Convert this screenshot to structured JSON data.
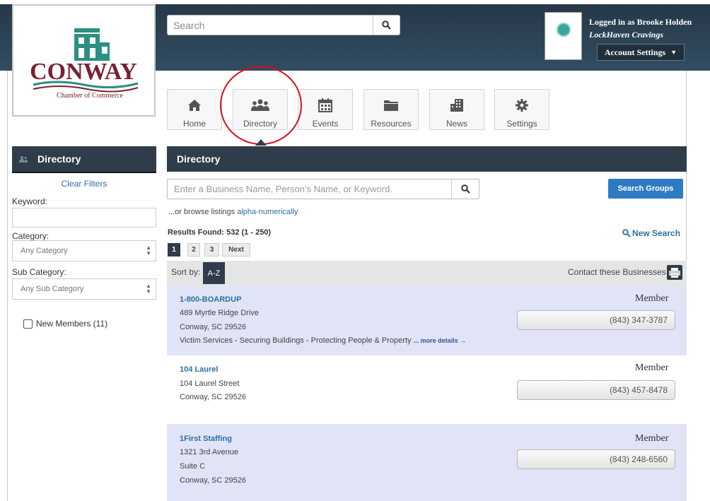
{
  "header": {
    "search_placeholder": "Search",
    "logged_in_as": "Logged in as Brooke Holden",
    "business": "LockHaven Cravings",
    "account_settings": "Account Settings",
    "logo_main": "CONWAY",
    "logo_sub": "Chamber of Commerce"
  },
  "nav": [
    {
      "label": "Home",
      "icon": "home-icon"
    },
    {
      "label": "Directory",
      "icon": "people-icon"
    },
    {
      "label": "Events",
      "icon": "calendar-icon"
    },
    {
      "label": "Resources",
      "icon": "folder-icon"
    },
    {
      "label": "News",
      "icon": "building-icon"
    },
    {
      "label": "Settings",
      "icon": "gear-icon"
    }
  ],
  "sidebar": {
    "title": "Directory",
    "clear_filters": "Clear Filters",
    "keyword_label": "Keyword:",
    "category_label": "Category:",
    "category_value": "Any Category",
    "subcategory_label": "Sub Category:",
    "subcategory_value": "Any Sub Category",
    "new_members": "New Members (11)"
  },
  "main": {
    "title": "Directory",
    "search_placeholder": "Enter a Business Name, Person's Name, or Keyword.",
    "search_groups": "Search Groups",
    "browse_prefix": "...or browse listings ",
    "browse_link": "alpha-numerically",
    "results": "Results Found: 532 (1 - 250)",
    "new_search": "New Search",
    "pages": [
      "1",
      "2",
      "3",
      "Next"
    ],
    "sort_by": "Sort by:",
    "sort_value": "A-Z",
    "contact": "Contact these Businesses"
  },
  "listings": [
    {
      "name": "1-800-BOARDUP",
      "lines": [
        "489 Myrtle Ridge Drive",
        "Conway, SC 29526"
      ],
      "description": "Victim Services - Securing Buildings - Protecting People & Property",
      "more": "... more details →",
      "member": "Member",
      "phone": "(843) 347-3787"
    },
    {
      "name": "104 Laurel",
      "lines": [
        "104 Laurel Street",
        "Conway, SC 29526"
      ],
      "member": "Member",
      "phone": "(843) 457-8478"
    },
    {
      "name": "1First Staffing",
      "lines": [
        "1321 3rd Avenue",
        "Suite C",
        "Conway, SC 29526"
      ],
      "member": "Member",
      "phone": "(843) 248-6560"
    }
  ]
}
